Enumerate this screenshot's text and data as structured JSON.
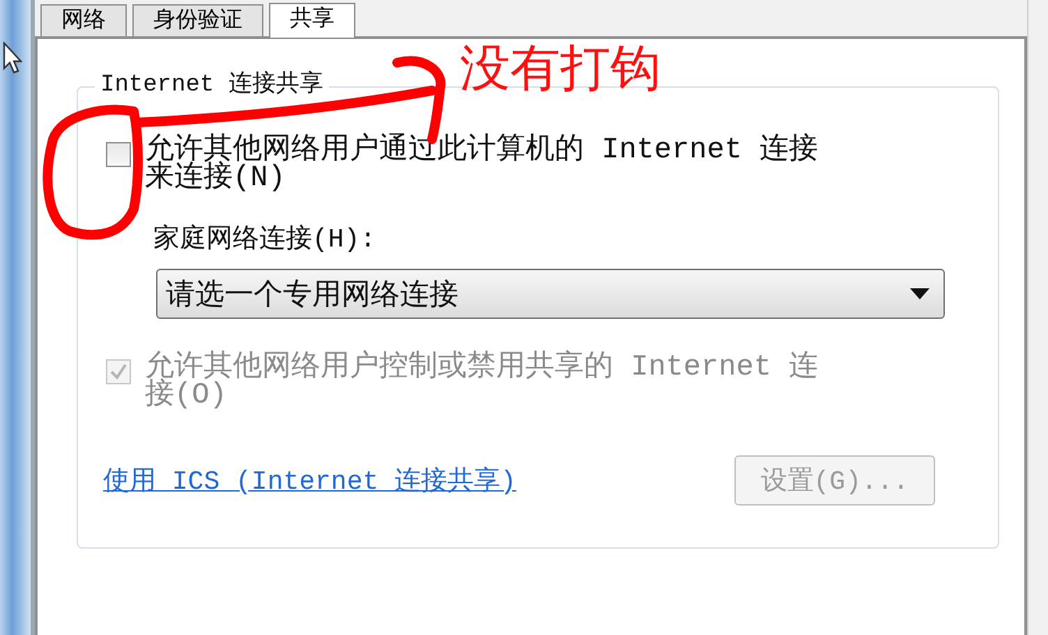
{
  "tabs": [
    {
      "label": "网络",
      "selected": false
    },
    {
      "label": "身份验证",
      "selected": false
    },
    {
      "label": "共享",
      "selected": true
    }
  ],
  "group": {
    "title": "Internet 连接共享"
  },
  "options": [
    {
      "kind": "checkbox",
      "label": "允许其他网络用户通过此计算机的 Internet 连接来连接(N)",
      "checked": false,
      "disabled": false
    },
    {
      "kind": "label",
      "label": "家庭网络连接(H):"
    },
    {
      "kind": "dropdown",
      "value": "请选一个专用网络连接"
    },
    {
      "kind": "checkbox",
      "label": "允许其他网络用户控制或禁用共享的 Internet 连接(O)",
      "checked": true,
      "disabled": true
    }
  ],
  "link": "使用 ICS (Internet 连接共享)",
  "settings_button": {
    "label": "设置(G)...",
    "disabled": true
  },
  "annotation": {
    "text": "没有打钩"
  }
}
